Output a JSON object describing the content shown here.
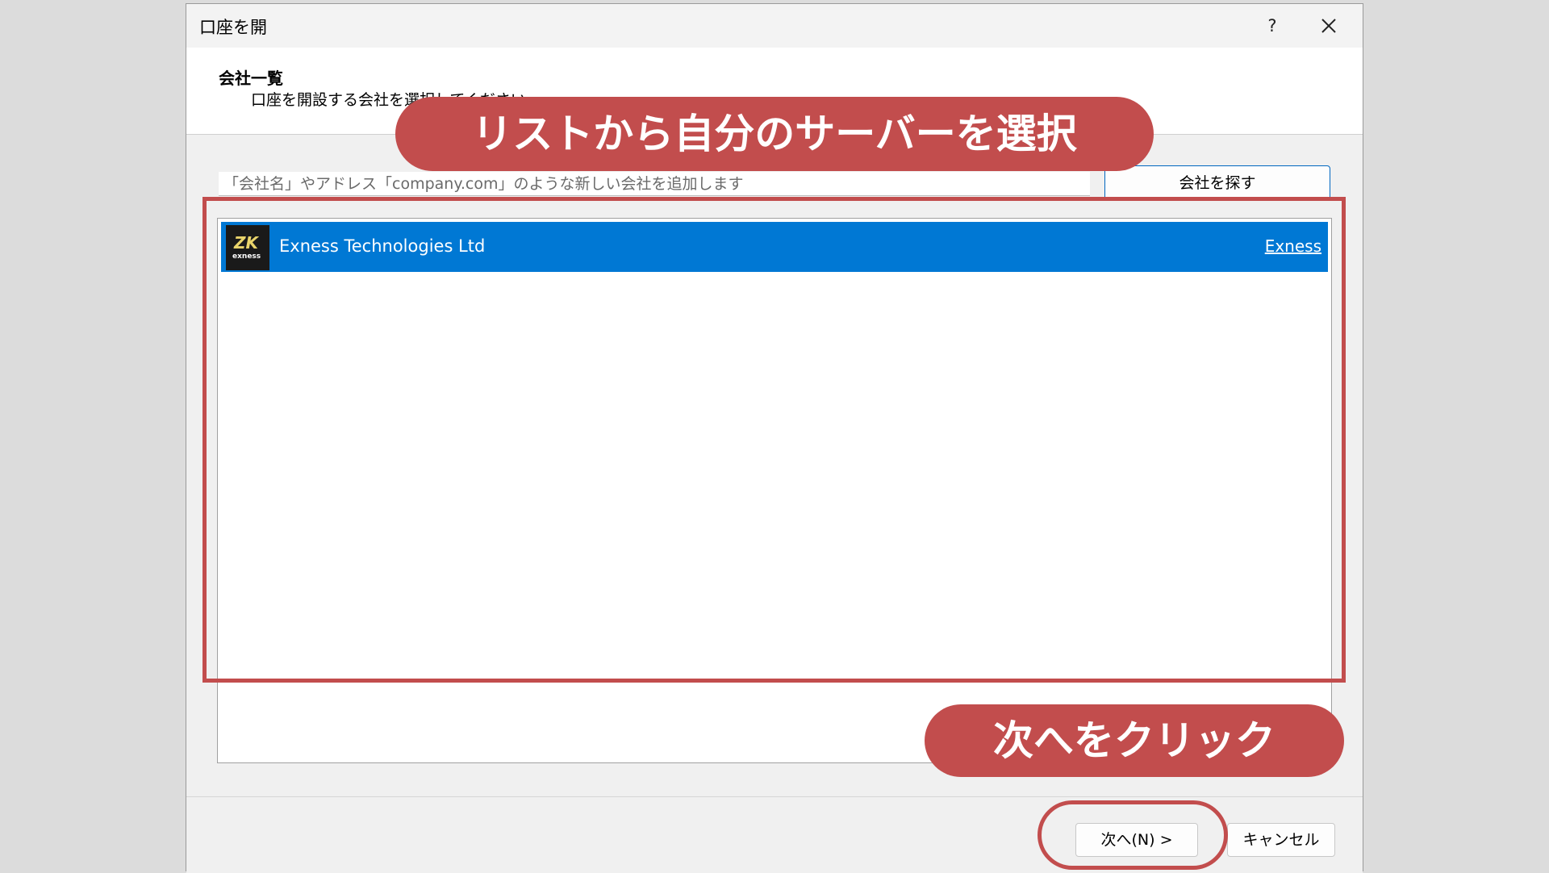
{
  "window": {
    "title": "口座を開",
    "help_label": "?"
  },
  "header": {
    "title": "会社一覧",
    "subtitle": "口座を開設する会社を選択してください"
  },
  "search": {
    "placeholder": "「会社名」やアドレス「company.com」のような新しい会社を追加します",
    "value": "",
    "find_button_label": "会社を探す"
  },
  "companies": [
    {
      "name": "Exness Technologies Ltd",
      "link_label": "Exness",
      "logo_mark": "ZK",
      "logo_text": "exness",
      "selected": true
    }
  ],
  "footer": {
    "next_label": "次へ(N) >",
    "cancel_label": "キャンセル"
  },
  "annotations": {
    "top_banner": "リストから自分のサーバーを選択",
    "bottom_banner": "次へをクリック",
    "color": "#c24d4d"
  },
  "colors": {
    "selection": "#0078d4",
    "accent_border": "#0067c0"
  }
}
